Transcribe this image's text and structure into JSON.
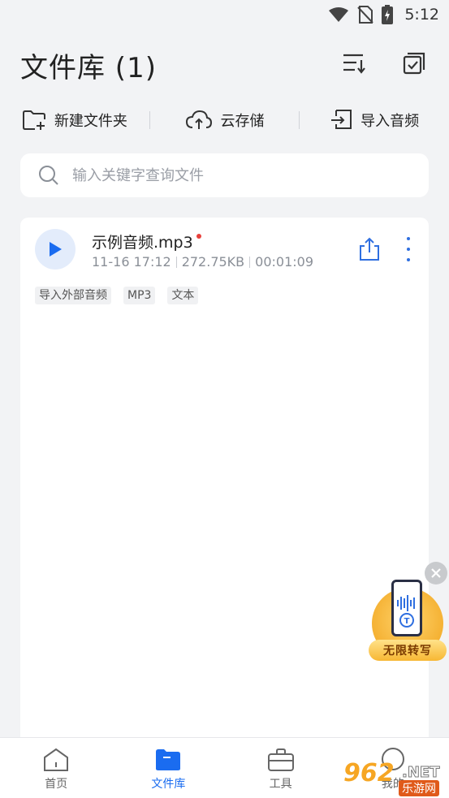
{
  "status_bar": {
    "time": "5:12"
  },
  "header": {
    "title": "文件库 (1)"
  },
  "actions": {
    "new_folder": "新建文件夹",
    "cloud_storage": "云存储",
    "import_audio": "导入音频"
  },
  "search": {
    "placeholder": "输入关键字查询文件"
  },
  "files": [
    {
      "name": "示例音频.mp3",
      "date": "11-16 17:12",
      "size": "272.75KB",
      "duration": "00:01:09",
      "tags": [
        "导入外部音频",
        "MP3",
        "文本"
      ]
    }
  ],
  "promo": {
    "label": "无限转写"
  },
  "bottom_nav": {
    "home": "首页",
    "library": "文件库",
    "tools": "工具",
    "mine": "我的"
  },
  "watermark": {
    "num": "962",
    "net": ".NET",
    "cn": "乐游网"
  },
  "colors": {
    "accent": "#1a6cf0",
    "background": "#f2f3f5",
    "new_dot": "#e8413c"
  }
}
